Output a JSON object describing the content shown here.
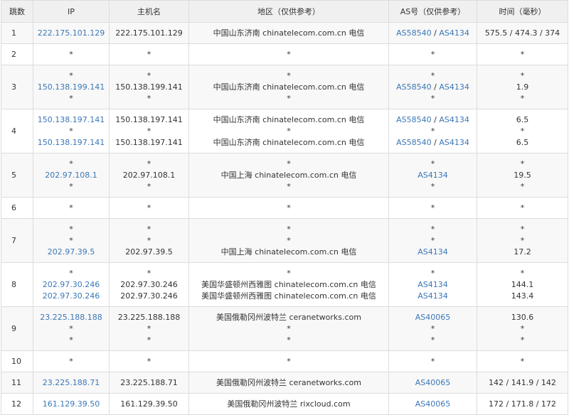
{
  "headers": {
    "hop": "跳数",
    "ip": "IP",
    "host": "主机名",
    "region": "地区（仅供参考）",
    "as": "AS号（仅供参考）",
    "time": "时间（毫秒）"
  },
  "rows": [
    {
      "hop": "1",
      "ip": [
        "222.175.101.129"
      ],
      "host": [
        "222.175.101.129"
      ],
      "region": [
        "中国山东济南 chinatelecom.com.cn 电信"
      ],
      "as": [
        [
          "AS58540",
          "AS4134"
        ]
      ],
      "time": [
        "575.5 / 474.3 / 374"
      ]
    },
    {
      "hop": "2",
      "ip": [
        "*"
      ],
      "host": [
        "*"
      ],
      "region": [
        "*"
      ],
      "as": [
        [
          "*"
        ]
      ],
      "time": [
        "*"
      ]
    },
    {
      "hop": "3",
      "ip": [
        "*",
        "150.138.199.141",
        "*"
      ],
      "host": [
        "*",
        "150.138.199.141",
        "*"
      ],
      "region": [
        "*",
        "中国山东济南 chinatelecom.com.cn 电信",
        "*"
      ],
      "as": [
        [
          "*"
        ],
        [
          "AS58540",
          "AS4134"
        ],
        [
          "*"
        ]
      ],
      "time": [
        "*",
        "1.9",
        "*"
      ]
    },
    {
      "hop": "4",
      "ip": [
        "150.138.197.141",
        "*",
        "150.138.197.141"
      ],
      "host": [
        "150.138.197.141",
        "*",
        "150.138.197.141"
      ],
      "region": [
        "中国山东济南 chinatelecom.com.cn 电信",
        "*",
        "中国山东济南 chinatelecom.com.cn 电信"
      ],
      "as": [
        [
          "AS58540",
          "AS4134"
        ],
        [
          "*"
        ],
        [
          "AS58540",
          "AS4134"
        ]
      ],
      "time": [
        "6.5",
        "*",
        "6.5"
      ]
    },
    {
      "hop": "5",
      "ip": [
        "*",
        "202.97.108.1",
        "*"
      ],
      "host": [
        "*",
        "202.97.108.1",
        "*"
      ],
      "region": [
        "*",
        "中国上海 chinatelecom.com.cn 电信",
        "*"
      ],
      "as": [
        [
          "*"
        ],
        [
          "AS4134"
        ],
        [
          "*"
        ]
      ],
      "time": [
        "*",
        "19.5",
        "*"
      ]
    },
    {
      "hop": "6",
      "ip": [
        "*"
      ],
      "host": [
        "*"
      ],
      "region": [
        "*"
      ],
      "as": [
        [
          "*"
        ]
      ],
      "time": [
        "*"
      ]
    },
    {
      "hop": "7",
      "ip": [
        "*",
        "*",
        "202.97.39.5"
      ],
      "host": [
        "*",
        "*",
        "202.97.39.5"
      ],
      "region": [
        "*",
        "*",
        "中国上海 chinatelecom.com.cn 电信"
      ],
      "as": [
        [
          "*"
        ],
        [
          "*"
        ],
        [
          "AS4134"
        ]
      ],
      "time": [
        "*",
        "*",
        "17.2"
      ]
    },
    {
      "hop": "8",
      "ip": [
        "*",
        "202.97.30.246",
        "202.97.30.246"
      ],
      "host": [
        "*",
        "202.97.30.246",
        "202.97.30.246"
      ],
      "region": [
        "*",
        "美国华盛顿州西雅图 chinatelecom.com.cn 电信",
        "美国华盛顿州西雅图 chinatelecom.com.cn 电信"
      ],
      "as": [
        [
          "*"
        ],
        [
          "AS4134"
        ],
        [
          "AS4134"
        ]
      ],
      "time": [
        "*",
        "144.1",
        "143.4"
      ]
    },
    {
      "hop": "9",
      "ip": [
        "23.225.188.188",
        "*",
        "*"
      ],
      "host": [
        "23.225.188.188",
        "*",
        "*"
      ],
      "region": [
        "美国俄勒冈州波特兰 ceranetworks.com",
        "*",
        "*"
      ],
      "as": [
        [
          "AS40065"
        ],
        [
          "*"
        ],
        [
          "*"
        ]
      ],
      "time": [
        "130.6",
        "*",
        "*"
      ]
    },
    {
      "hop": "10",
      "ip": [
        "*"
      ],
      "host": [
        "*"
      ],
      "region": [
        "*"
      ],
      "as": [
        [
          "*"
        ]
      ],
      "time": [
        "*"
      ]
    },
    {
      "hop": "11",
      "ip": [
        "23.225.188.71"
      ],
      "host": [
        "23.225.188.71"
      ],
      "region": [
        "美国俄勒冈州波特兰 ceranetworks.com"
      ],
      "as": [
        [
          "AS40065"
        ]
      ],
      "time": [
        "142 / 141.9 / 142"
      ]
    },
    {
      "hop": "12",
      "ip": [
        "161.129.39.50"
      ],
      "host": [
        "161.129.39.50"
      ],
      "region": [
        "美国俄勒冈州波特兰 rixcloud.com"
      ],
      "as": [
        [
          "AS40065"
        ]
      ],
      "time": [
        "172 / 171.8 / 172"
      ]
    }
  ]
}
